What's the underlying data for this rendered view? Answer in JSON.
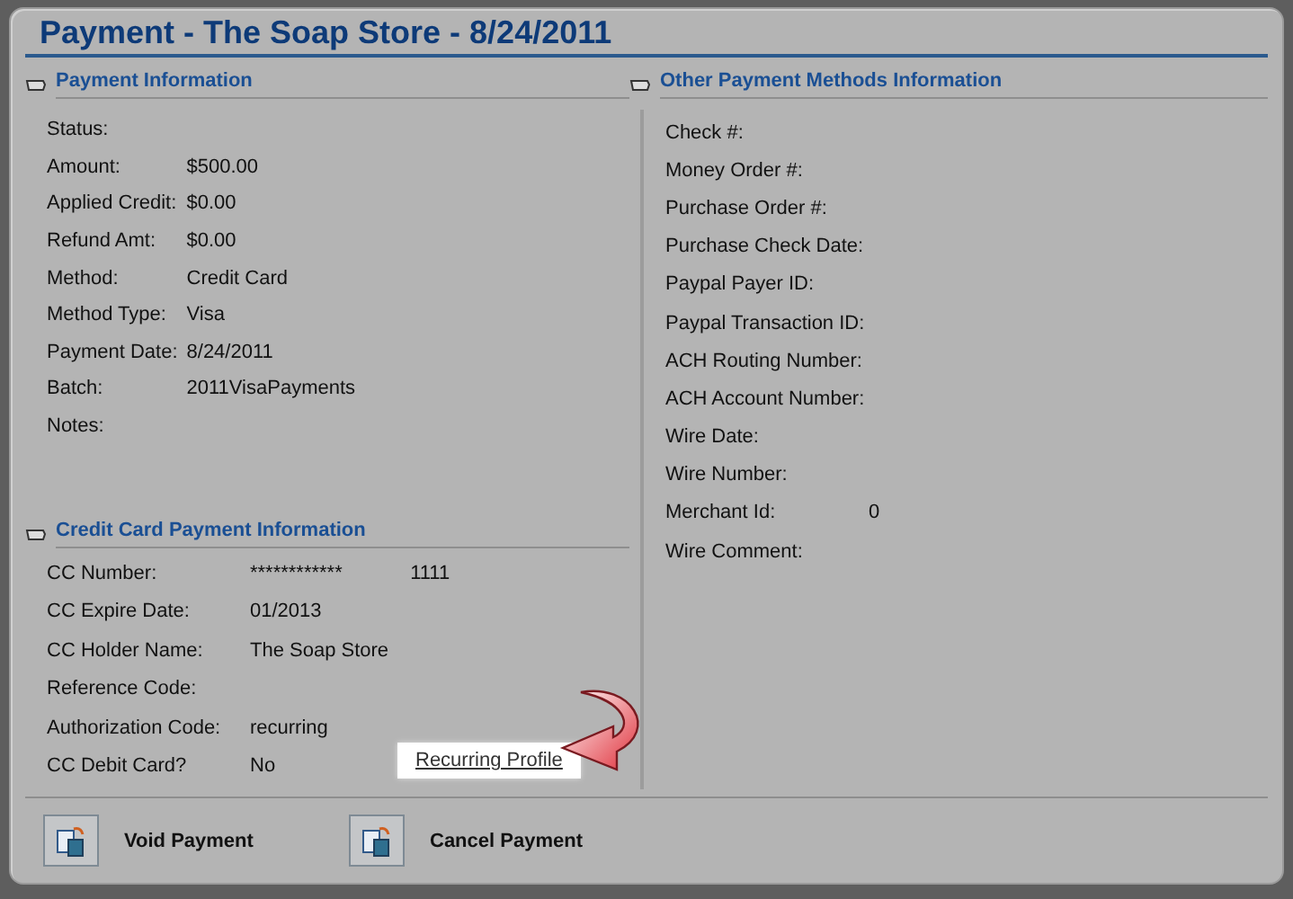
{
  "title": "Payment - The Soap Store - 8/24/2011",
  "payment_info": {
    "heading": "Payment Information",
    "fields": [
      {
        "label": "Status:"
      },
      {
        "label": "Amount:",
        "value": "$500.00"
      },
      {
        "label": "Applied Credit:",
        "value": "$0.00"
      },
      {
        "label": "Refund Amt:",
        "value": "$0.00"
      },
      {
        "label": "Method:",
        "value": "Credit Card"
      },
      {
        "label": "Method Type:",
        "value": "Visa"
      },
      {
        "label": "Payment Date:",
        "value": "8/24/2011"
      },
      {
        "label": "Batch:",
        "value": "2011VisaPayments"
      },
      {
        "label": "Notes:"
      }
    ]
  },
  "credit_card": {
    "heading": "Credit Card Payment Information",
    "fields": [
      {
        "label": "CC Number:",
        "value": "************",
        "value_2": "1111"
      },
      {
        "label": "CC Expire Date:",
        "value": "01/2013"
      },
      {
        "label": "CC Holder Name:",
        "value": "The Soap Store"
      },
      {
        "label": "Reference Code:"
      },
      {
        "label": "Authorization Code:",
        "value": "recurring"
      },
      {
        "label": "CC Debit Card?",
        "value": "No"
      }
    ],
    "link": "Recurring Profile"
  },
  "other_methods": {
    "heading": "Other Payment Methods Information",
    "fields": [
      {
        "label": "Check #:"
      },
      {
        "label": "Money Order #:"
      },
      {
        "label": "Purchase Order #:"
      },
      {
        "label": "Purchase Check Date:"
      },
      {
        "label": "Paypal Payer ID:"
      },
      {
        "label": "Paypal Transaction ID:"
      },
      {
        "label": "ACH Routing Number:"
      },
      {
        "label": "ACH Account Number:"
      },
      {
        "label": "Wire Date:"
      },
      {
        "label": "Wire Number:"
      },
      {
        "label": "Merchant Id:",
        "value": "0"
      },
      {
        "label": "Wire Comment:"
      }
    ]
  },
  "buttons": [
    "Void Payment",
    "Cancel Payment"
  ]
}
